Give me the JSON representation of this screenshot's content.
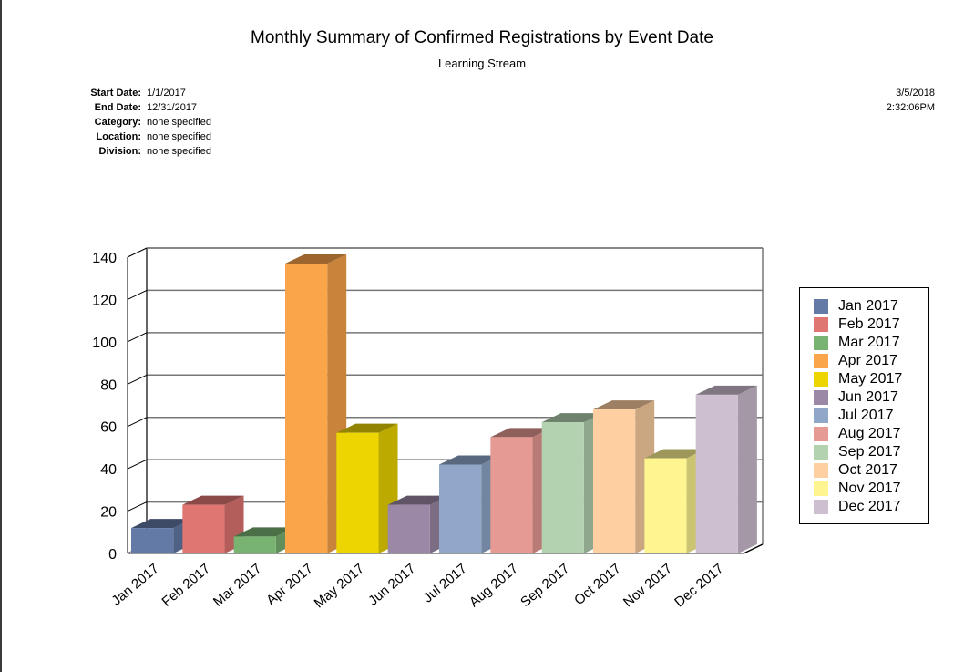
{
  "report": {
    "title": "Monthly Summary of Confirmed Registrations by Event Date",
    "subtitle": "Learning Stream",
    "params": [
      {
        "label": "Start Date:",
        "value": "1/1/2017"
      },
      {
        "label": "End Date:",
        "value": "12/31/2017"
      },
      {
        "label": "Category:",
        "value": "none specified"
      },
      {
        "label": "Location:",
        "value": "none specified"
      },
      {
        "label": "Division:",
        "value": "none specified"
      }
    ],
    "date": "3/5/2018",
    "time": "2:32:06PM"
  },
  "chart_data": {
    "type": "bar",
    "style": "3d",
    "title": "Monthly Summary of Confirmed Registrations by Event Date",
    "subtitle": "Learning Stream",
    "xlabel": "",
    "ylabel": "",
    "categories": [
      "Jan 2017",
      "Feb 2017",
      "Mar 2017",
      "Apr 2017",
      "May 2017",
      "Jun 2017",
      "Jul 2017",
      "Aug 2017",
      "Sep 2017",
      "Oct 2017",
      "Nov 2017",
      "Dec 2017"
    ],
    "values": [
      12,
      23,
      8,
      137,
      57,
      23,
      42,
      55,
      62,
      68,
      45,
      75
    ],
    "colors": [
      "#6379a6",
      "#e07672",
      "#79b372",
      "#fba54a",
      "#ecd500",
      "#9b88a6",
      "#90a7c9",
      "#e69a94",
      "#b3d2b0",
      "#fdcfa1",
      "#fef590",
      "#cdbed0"
    ],
    "ylim": [
      0,
      140
    ],
    "yticks": [
      0,
      20,
      40,
      60,
      80,
      100,
      120,
      140
    ],
    "grid": true,
    "legend": {
      "position": "right",
      "entries": [
        "Jan 2017",
        "Feb 2017",
        "Mar 2017",
        "Apr 2017",
        "May 2017",
        "Jun 2017",
        "Jul 2017",
        "Aug 2017",
        "Sep 2017",
        "Oct 2017",
        "Nov 2017",
        "Dec 2017"
      ]
    }
  }
}
